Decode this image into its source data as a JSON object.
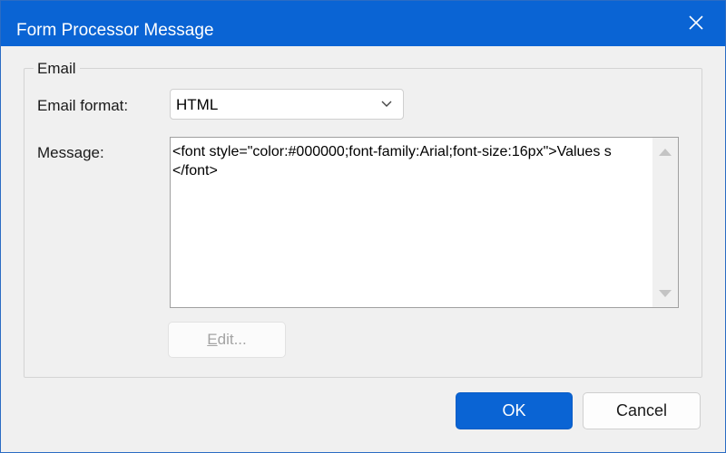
{
  "window": {
    "title": "Form Processor Message",
    "title_bar_color": "#0a64d4"
  },
  "group": {
    "legend": "Email"
  },
  "email_format": {
    "label": "Email format:",
    "selected": "HTML"
  },
  "message": {
    "label": "Message:",
    "line1": "<font style=\"color:#000000;font-family:Arial;font-size:16px\">Values s",
    "line2": "</font>"
  },
  "buttons": {
    "edit_access_key": "E",
    "edit_rest": "dit...",
    "ok": "OK",
    "cancel": "Cancel"
  },
  "icons": {
    "close": "close-icon",
    "dropdown": "chevron-down-icon",
    "scroll_up": "scroll-up-arrow-icon",
    "scroll_down": "scroll-down-arrow-icon"
  }
}
